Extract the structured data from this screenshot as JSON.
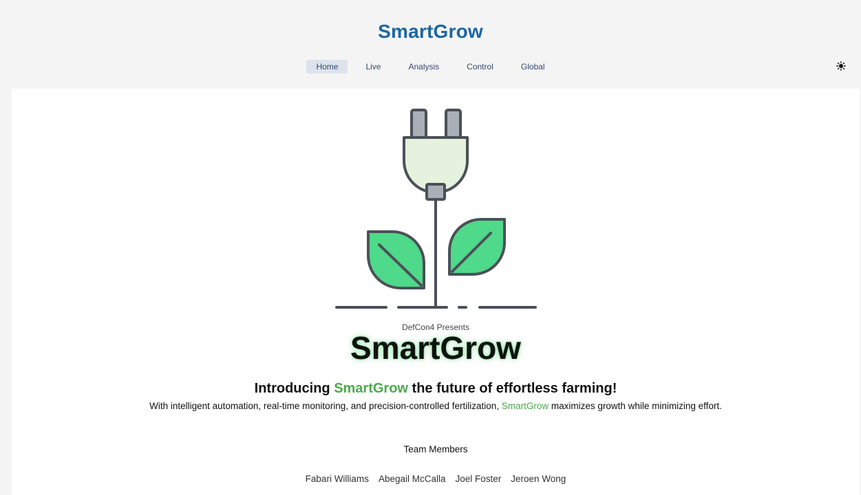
{
  "header": {
    "brand": "SmartGrow",
    "nav": [
      {
        "label": "Home",
        "active": true
      },
      {
        "label": "Live",
        "active": false
      },
      {
        "label": "Analysis",
        "active": false
      },
      {
        "label": "Control",
        "active": false
      },
      {
        "label": "Global",
        "active": false
      }
    ],
    "theme_toggle_icon": "sun-icon"
  },
  "hero": {
    "logo_icon": "plug-plant-icon",
    "presents": "DefCon4 Presents",
    "title": "SmartGrow",
    "headline": {
      "before": "Introducing ",
      "brand": "SmartGrow",
      "after": " the future of effortless farming!"
    },
    "description": {
      "before": "With intelligent automation, real-time monitoring, and precision-controlled fertilization, ",
      "brand": "SmartGrow",
      "after": " maximizes growth while minimizing effort."
    }
  },
  "team": {
    "heading": "Team Members",
    "members": [
      "Fabari Williams",
      "Abegail McCalla",
      "Joel Foster",
      "Jeroen Wong"
    ]
  },
  "colors": {
    "brand_blue": "#1b66a3",
    "accent_green": "#4aaa4c",
    "leaf_green": "#4fd98a",
    "plug_body": "#e5f2dd",
    "outline": "#4b5058"
  }
}
